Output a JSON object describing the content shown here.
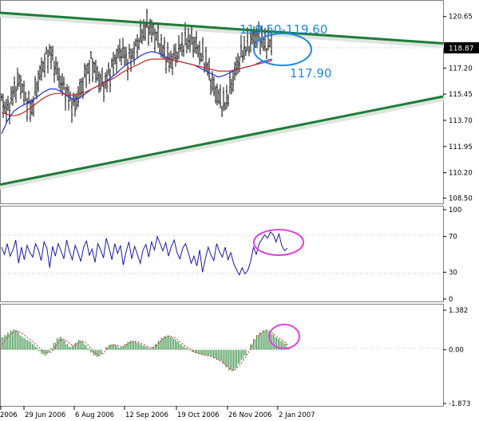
{
  "chart_data": [
    {
      "type": "candlestick",
      "panel": "price",
      "y_ticks": [
        "120.65",
        "118.87",
        "117.20",
        "115.45",
        "113.70",
        "111.95",
        "110.20",
        "108.50"
      ],
      "y_tick_values": [
        120.65,
        118.87,
        117.2,
        115.45,
        113.7,
        111.95,
        110.2,
        108.5
      ],
      "ylim": [
        108.15,
        121.7
      ],
      "current_price": "118.87",
      "price_path": [
        115.0,
        114.3,
        115.6,
        116.4,
        115.1,
        114.4,
        116.3,
        117.5,
        118.3,
        117.2,
        116.1,
        115.4,
        114.6,
        115.6,
        116.8,
        117.6,
        116.6,
        116.0,
        116.9,
        117.9,
        118.4,
        117.6,
        118.3,
        119.2,
        120.0,
        119.7,
        119.1,
        118.2,
        117.6,
        118.1,
        118.7,
        119.1,
        118.9,
        118.2,
        117.6,
        116.1,
        115.3,
        114.6,
        115.8,
        117.2,
        118.3,
        118.7,
        119.3,
        119.2,
        118.7,
        119.0
      ],
      "moving_averages": [
        {
          "color": "#1f2fd6",
          "values": [
            112.8,
            113.7,
            114.3,
            114.6,
            114.8,
            115.0,
            115.3,
            115.6,
            115.8,
            115.8,
            115.6,
            115.3,
            115.1,
            115.2,
            115.5,
            115.8,
            116.0,
            116.2,
            116.5,
            116.8,
            117.2,
            117.5,
            117.7,
            118.0,
            118.2,
            118.3,
            118.2,
            118.0,
            117.8,
            117.7,
            117.6,
            117.5,
            117.4,
            117.2,
            117.0,
            116.8,
            116.6,
            116.7,
            116.9,
            117.1,
            117.2,
            117.3,
            117.4,
            117.6,
            117.7,
            117.8
          ]
        },
        {
          "color": "#c62828",
          "values": [
            114.2,
            114.1,
            114.0,
            114.1,
            114.3,
            114.6,
            114.9,
            115.2,
            115.4,
            115.5,
            115.5,
            115.4,
            115.4,
            115.5,
            115.6,
            115.8,
            116.0,
            116.2,
            116.4,
            116.6,
            116.9,
            117.1,
            117.3,
            117.5,
            117.7,
            117.8,
            117.8,
            117.8,
            117.8,
            117.7,
            117.6,
            117.5,
            117.4,
            117.3,
            117.2,
            117.1,
            117.0,
            117.0,
            117.0,
            117.1,
            117.2,
            117.3,
            117.4,
            117.5,
            117.6,
            117.7
          ]
        }
      ],
      "trendlines": [
        {
          "name": "upper",
          "color": "#1e7b3a",
          "from": [
            0,
            120.9
          ],
          "to": [
            53,
            118.85
          ]
        },
        {
          "name": "lower",
          "color": "#1e7b3a",
          "from": [
            0,
            109.4
          ],
          "to": [
            53,
            115.3
          ]
        }
      ],
      "annotations": [
        {
          "text": "119.50-119.60",
          "price": 120.5,
          "color": "#1e88e5"
        },
        {
          "text": "117.90",
          "price": 117.35,
          "color": "#1e88e5"
        }
      ]
    },
    {
      "type": "line",
      "panel": "oscillator",
      "y_ticks": [
        "100",
        "70",
        "30",
        "0"
      ],
      "y_tick_values": [
        100,
        70,
        30,
        0
      ],
      "ylim": [
        0,
        100
      ],
      "color": "#1a1aa8",
      "values": [
        58,
        50,
        62,
        48,
        55,
        66,
        40,
        58,
        44,
        60,
        52,
        47,
        62,
        55,
        43,
        64,
        57,
        35,
        59,
        48,
        62,
        54,
        45,
        66,
        53,
        44,
        60,
        52,
        42,
        58,
        65,
        49,
        56,
        41,
        62,
        55,
        46,
        68,
        57,
        44,
        62,
        51,
        60,
        38,
        53,
        64,
        45,
        59,
        50,
        40,
        55,
        61,
        47,
        64,
        55,
        70,
        62,
        54,
        63,
        48,
        59,
        66,
        52,
        45,
        57,
        62,
        52,
        40,
        48,
        37,
        55,
        30,
        45,
        58,
        49,
        43,
        62,
        53,
        47,
        58,
        44,
        52,
        40,
        33,
        27,
        35,
        28,
        32,
        42,
        58,
        50,
        62,
        67,
        72,
        68,
        75,
        72,
        64,
        73,
        60,
        54,
        57
      ]
    },
    {
      "type": "histogram",
      "panel": "macd",
      "y_ticks": [
        "1.382",
        "0.00",
        "-1.873"
      ],
      "y_tick_values": [
        1.382,
        0.0,
        -1.873
      ],
      "ylim": [
        -1.873,
        1.382
      ],
      "bar_color": "#2e8b3e",
      "signal_color": "#d32f2f",
      "values": [
        0.45,
        0.52,
        0.6,
        0.68,
        0.72,
        0.65,
        0.5,
        0.42,
        0.35,
        0.3,
        0.2,
        0.1,
        -0.05,
        -0.15,
        -0.2,
        -0.1,
        0.05,
        0.25,
        0.4,
        0.45,
        0.35,
        0.2,
        0.1,
        0.15,
        0.25,
        0.35,
        0.3,
        0.18,
        0.05,
        -0.1,
        -0.2,
        -0.25,
        -0.15,
        0.0,
        0.1,
        0.18,
        0.2,
        0.15,
        0.08,
        0.12,
        0.2,
        0.28,
        0.32,
        0.3,
        0.25,
        0.2,
        0.15,
        0.1,
        0.05,
        0.1,
        0.2,
        0.32,
        0.42,
        0.48,
        0.5,
        0.45,
        0.38,
        0.3,
        0.2,
        0.12,
        0.05,
        -0.02,
        -0.08,
        -0.12,
        -0.15,
        -0.18,
        -0.2,
        -0.22,
        -0.25,
        -0.3,
        -0.35,
        -0.4,
        -0.5,
        -0.62,
        -0.72,
        -0.75,
        -0.65,
        -0.5,
        -0.35,
        -0.2,
        0.0,
        0.2,
        0.38,
        0.52,
        0.62,
        0.68,
        0.7,
        0.62,
        0.55,
        0.45,
        0.38,
        0.3,
        0.22,
        0.1
      ],
      "signal": [
        0.2,
        0.35,
        0.48,
        0.58,
        0.64,
        0.66,
        0.6,
        0.52,
        0.44,
        0.36,
        0.27,
        0.18,
        0.08,
        -0.02,
        -0.1,
        -0.12,
        -0.06,
        0.08,
        0.22,
        0.34,
        0.37,
        0.3,
        0.2,
        0.15,
        0.18,
        0.26,
        0.3,
        0.26,
        0.16,
        0.02,
        -0.1,
        -0.18,
        -0.18,
        -0.1,
        0.02,
        0.12,
        0.17,
        0.17,
        0.12,
        0.1,
        0.14,
        0.22,
        0.28,
        0.3,
        0.28,
        0.23,
        0.18,
        0.13,
        0.08,
        0.08,
        0.14,
        0.24,
        0.35,
        0.43,
        0.48,
        0.47,
        0.42,
        0.35,
        0.26,
        0.17,
        0.1,
        0.03,
        -0.04,
        -0.09,
        -0.13,
        -0.16,
        -0.19,
        -0.21,
        -0.24,
        -0.28,
        -0.33,
        -0.38,
        -0.46,
        -0.56,
        -0.66,
        -0.72,
        -0.68,
        -0.57,
        -0.43,
        -0.28,
        -0.1,
        0.1,
        0.28,
        0.44,
        0.56,
        0.64,
        0.68,
        0.65,
        0.58,
        0.5,
        0.42,
        0.34,
        0.26,
        0.16
      ]
    }
  ],
  "x_ticks": [
    "2006",
    "29 Jun 2006",
    "6 Aug 2006",
    "12 Sep 2006",
    "19 Oct 2006",
    "26 Nov 2006",
    "2 Jan 2007"
  ],
  "highlight_colors": {
    "ellipse_blue": "#1e88e5",
    "ellipse_magenta": "#e040e0",
    "current_price_label_bg": "#000000"
  }
}
